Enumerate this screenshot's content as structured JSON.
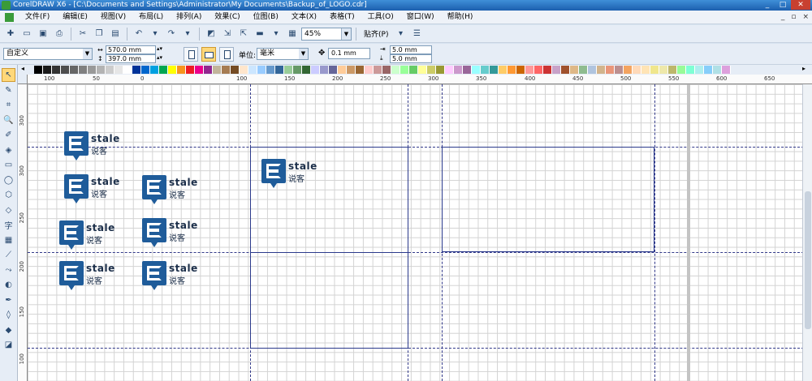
{
  "window": {
    "title": "CorelDRAW X6 - [C:\\Documents and Settings\\Administrator\\My Documents\\Backup_of_LOGO.cdr]"
  },
  "menu": {
    "items": [
      "文件(F)",
      "编辑(E)",
      "视图(V)",
      "布局(L)",
      "排列(A)",
      "效果(C)",
      "位图(B)",
      "文本(X)",
      "表格(T)",
      "工具(O)",
      "窗口(W)",
      "帮助(H)"
    ]
  },
  "toolbar": {
    "zoom": "45%",
    "snap_label": "贴齐(P)"
  },
  "property_bar": {
    "preset": "自定义",
    "width": "570.0 mm",
    "height": "397.0 mm",
    "unit_label": "单位:",
    "unit_value": "毫米",
    "nudge": "0.1 mm",
    "dup_x": "5.0 mm",
    "dup_y": "5.0 mm"
  },
  "palette": {
    "colors": [
      "#000000",
      "#1a1a1a",
      "#333333",
      "#4d4d4d",
      "#666666",
      "#808080",
      "#999999",
      "#b3b3b3",
      "#cccccc",
      "#e6e6e6",
      "#ffffff",
      "#003399",
      "#0066cc",
      "#00a0e0",
      "#00a651",
      "#ffff00",
      "#f7941d",
      "#ed1c24",
      "#ec008c",
      "#92278f",
      "#c2b59b",
      "#a67c52",
      "#754c24",
      "#ffe6cc",
      "#cce6ff",
      "#99ccff",
      "#6699cc",
      "#336699",
      "#99cc99",
      "#669966",
      "#336633",
      "#ccccff",
      "#9999cc",
      "#666699",
      "#ffcc99",
      "#cc9966",
      "#996633",
      "#ffcccc",
      "#cc9999",
      "#996666",
      "#ccffcc",
      "#99ff99",
      "#66cc66",
      "#ffff99",
      "#cccc66",
      "#999933",
      "#ffccff",
      "#cc99cc",
      "#996699",
      "#99ffff",
      "#66cccc",
      "#339999",
      "#ffcc66",
      "#ff9933",
      "#cc6600",
      "#ff9999",
      "#ff6666",
      "#cc3333",
      "#c8a2c8",
      "#a0522d",
      "#deb887",
      "#8fbc8f",
      "#b0c4de",
      "#d2b48c",
      "#e9967a",
      "#bc8f8f",
      "#f4a460",
      "#ffdab9",
      "#ffe4b5",
      "#f0e68c",
      "#eee8aa",
      "#bdb76b",
      "#98fb98",
      "#7fffd4",
      "#afeeee",
      "#87cefa",
      "#b0e0e6",
      "#dda0dd",
      "#ee82ee",
      "#ffb6c1",
      "#ffa07a",
      "#fa8072"
    ]
  },
  "rulers": {
    "h_labels": [
      "100",
      "50",
      "0",
      "50",
      "100",
      "150",
      "200",
      "250",
      "300",
      "350",
      "400",
      "450",
      "500",
      "550",
      "600",
      "650"
    ],
    "v_labels": [
      "300",
      "300",
      "250",
      "200",
      "150",
      "100"
    ]
  },
  "tools": [
    "pick-tool",
    "shape-tool",
    "crop-tool",
    "zoom-tool",
    "freehand-tool",
    "smart-fill-tool",
    "rectangle-tool",
    "ellipse-tool",
    "polygon-tool",
    "basic-shapes-tool",
    "text-tool",
    "table-tool",
    "dimension-tool",
    "connector-tool",
    "blend-tool",
    "eyedropper-tool",
    "outline-tool",
    "fill-tool",
    "interactive-fill-tool"
  ],
  "logos": [
    {
      "en": "stale",
      "cn": "说客"
    },
    {
      "en": "stale",
      "cn": "说客"
    },
    {
      "en": "stale",
      "cn": "说客"
    },
    {
      "en": "stale",
      "cn": "说客"
    },
    {
      "en": "stale",
      "cn": "说客"
    },
    {
      "en": "stale",
      "cn": "说客"
    },
    {
      "en": "stale",
      "cn": "说客"
    },
    {
      "en": "stale",
      "cn": "说客"
    }
  ]
}
